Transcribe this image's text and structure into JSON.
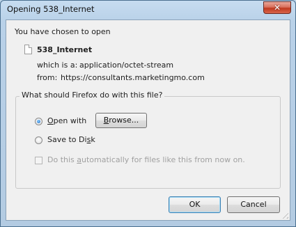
{
  "window": {
    "title": "Opening 538_Internet"
  },
  "titlebar": {
    "close_glyph": "✕"
  },
  "intro": "You have chosen to open",
  "file": {
    "name": "538_Internet",
    "type_label": "which is a:",
    "type_value": "application/octet-stream",
    "from_label": "from:",
    "from_value": "https://consultants.marketingmo.com"
  },
  "group": {
    "label": "What should Firefox do with this file?"
  },
  "options": {
    "open_with": {
      "label_pre": "",
      "accel": "O",
      "label_post": "pen with",
      "selected": true
    },
    "browse_button": {
      "label_pre": "",
      "accel": "B",
      "label_post": "rowse..."
    },
    "save_to_disk": {
      "label_pre": "Save to Di",
      "accel": "s",
      "label_post": "k",
      "selected": false
    },
    "auto_checkbox": {
      "label_pre": "Do this ",
      "accel": "a",
      "label_post": "utomatically for files like this from now on.",
      "checked": false,
      "enabled": false
    }
  },
  "buttons": {
    "ok": "OK",
    "cancel": "Cancel"
  }
}
